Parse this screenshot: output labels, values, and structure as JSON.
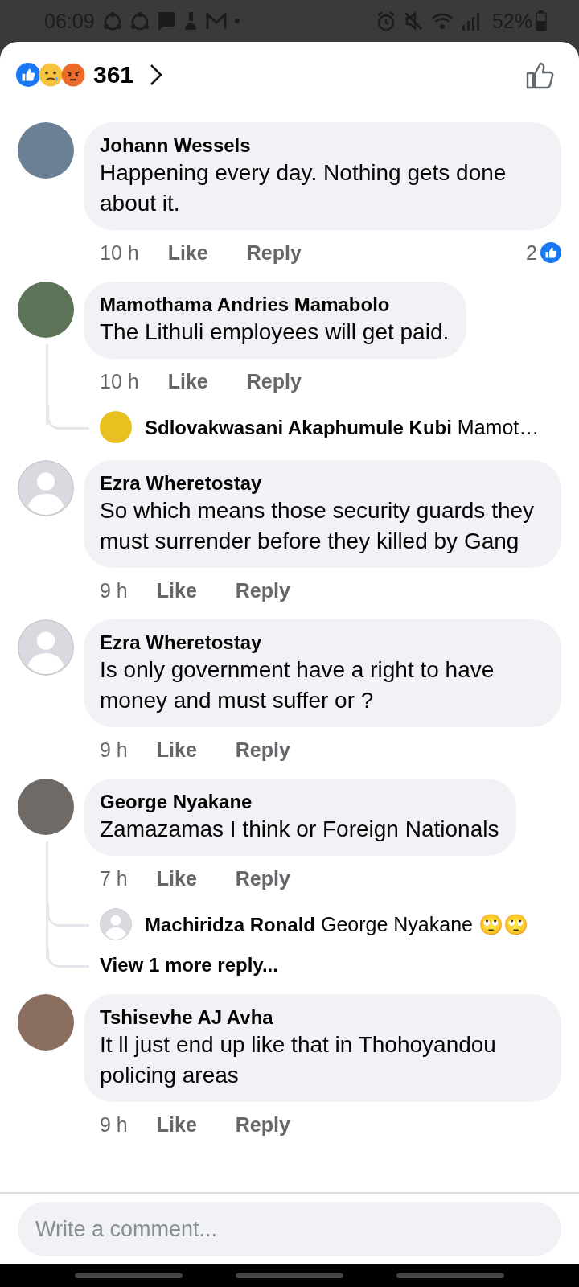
{
  "status_bar": {
    "time": "06:09",
    "battery": "52%"
  },
  "reactions": {
    "count": "361"
  },
  "comments": [
    {
      "author": "Johann Wessels",
      "avatar": {
        "kind": "photo"
      },
      "text": "Happening every day. Nothing gets done about it.",
      "time": "10 h",
      "like": "Like",
      "reply": "Reply",
      "reaction_count": "2"
    },
    {
      "author": "Mamothama Andries Mamabolo",
      "avatar": {
        "kind": "photo"
      },
      "text": "The Lithuli employees will get paid.",
      "time": "10 h",
      "like": "Like",
      "reply": "Reply",
      "replies": [
        {
          "author": "Sdlovakwasani Akaphumule  Kubi",
          "avatar": {
            "kind": "photo"
          },
          "text": "Mamot…"
        }
      ]
    },
    {
      "author": "Ezra Wheretostay",
      "avatar": {
        "kind": "default"
      },
      "text": "So which means those security guards they must surrender before they killed by Gang",
      "time": "9 h",
      "like": "Like",
      "reply": "Reply"
    },
    {
      "author": "Ezra Wheretostay",
      "avatar": {
        "kind": "default"
      },
      "text": "Is only government have a right to have money and must suffer or ?",
      "time": "9 h",
      "like": "Like",
      "reply": "Reply"
    },
    {
      "author": "George Nyakane",
      "avatar": {
        "kind": "photo"
      },
      "text": "Zamazamas I think or Foreign Nationals",
      "time": "7 h",
      "like": "Like",
      "reply": "Reply",
      "replies": [
        {
          "author": "Machiridza Ronald",
          "avatar": {
            "kind": "default"
          },
          "text": "George Nyakane 🙄🙄"
        }
      ],
      "more_replies": "View 1 more reply..."
    },
    {
      "author": "Tshisevhe AJ Avha",
      "avatar": {
        "kind": "photo"
      },
      "text": "It ll just end up  like that in Thohoyandou policing areas",
      "time": "9 h",
      "like": "Like",
      "reply": "Reply"
    }
  ],
  "composer": {
    "placeholder": "Write a comment..."
  }
}
